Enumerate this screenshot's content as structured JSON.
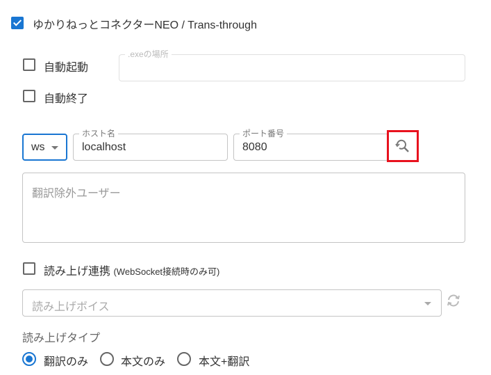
{
  "connector": {
    "label": "ゆかりねっとコネクターNEO / Trans-through",
    "checked": true
  },
  "auto_start": {
    "label": "自動起動",
    "checked": false
  },
  "auto_exit": {
    "label": "自動終了",
    "checked": false
  },
  "exe_path": {
    "label": ".exeの場所",
    "value": ""
  },
  "connection": {
    "protocol": "ws",
    "host_label": "ホスト名",
    "host_value": "localhost",
    "port_label": "ポート番号",
    "port_value": "8080",
    "search_icon": "search-refresh-icon"
  },
  "excluded_users": {
    "placeholder": "翻訳除外ユーザー"
  },
  "tts_link": {
    "label": "読み上げ連携",
    "note": "(WebSocket接続時のみ可)",
    "checked": false
  },
  "voice": {
    "placeholder": "読み上げボイス",
    "refresh_icon": "refresh-icon"
  },
  "read_type": {
    "label": "読み上げタイプ",
    "options": [
      "翻訳のみ",
      "本文のみ",
      "本文+翻訳"
    ],
    "selected": "翻訳のみ"
  },
  "colors": {
    "accent": "#1976d2",
    "highlight": "#e8121e"
  }
}
